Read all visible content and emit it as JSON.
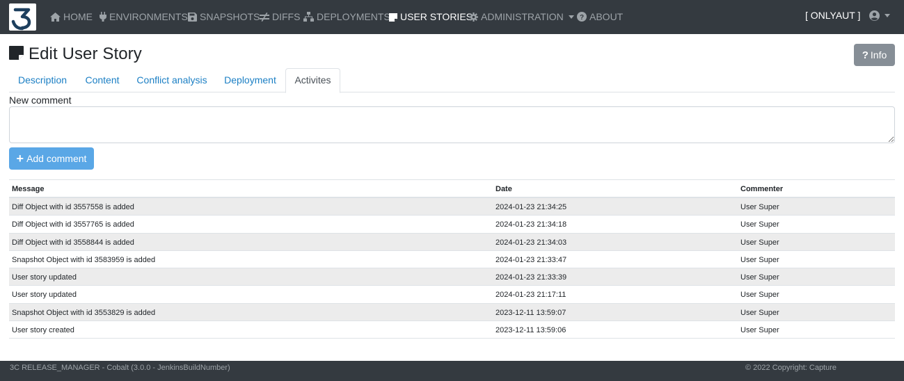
{
  "nav": {
    "items": [
      {
        "label": "HOME",
        "icon": "home-icon"
      },
      {
        "label": "ENVIRONMENTS",
        "icon": "plug-icon"
      },
      {
        "label": "SNAPSHOTS",
        "icon": "floppy-disk-icon"
      },
      {
        "label": "DIFFS",
        "icon": "not-equal-icon"
      },
      {
        "label": "DEPLOYMENTS",
        "icon": "sitemap-icon"
      },
      {
        "label": "USER STORIES",
        "icon": "sticky-note-icon"
      },
      {
        "label": "ADMINISTRATION",
        "icon": "gear-icon"
      },
      {
        "label": "ABOUT",
        "icon": "question-circle-icon"
      }
    ],
    "user": "[ ONLYAUT ]"
  },
  "page": {
    "title": "Edit User Story",
    "info_label": "Info"
  },
  "tabs": [
    "Description",
    "Content",
    "Conflict analysis",
    "Deployment",
    "Activites"
  ],
  "form": {
    "label": "New comment",
    "value": "",
    "add_label": "Add comment"
  },
  "table": {
    "columns": [
      "Message",
      "Date",
      "Commenter"
    ],
    "rows": [
      [
        "Diff Object with id 3557558 is added",
        "2024-01-23 21:34:25",
        "User Super"
      ],
      [
        "Diff Object with id 3557765 is added",
        "2024-01-23 21:34:18",
        "User Super"
      ],
      [
        "Diff Object with id 3558844 is added",
        "2024-01-23 21:34:03",
        "User Super"
      ],
      [
        "Snapshot Object with id 3583959 is added",
        "2024-01-23 21:33:47",
        "User Super"
      ],
      [
        "User story updated",
        "2024-01-23 21:33:39",
        "User Super"
      ],
      [
        "User story updated",
        "2024-01-23 21:17:11",
        "User Super"
      ],
      [
        "Snapshot Object with id 3553829 is added",
        "2023-12-11 13:59:07",
        "User Super"
      ],
      [
        "User story created",
        "2023-12-11 13:59:06",
        "User Super"
      ]
    ]
  },
  "footer": {
    "left": "3C RELEASE_MANAGER - Cobalt (3.0.0 - JenkinsBuildNumber)",
    "right": "© 2022 Copyright: Capture"
  },
  "colors": {
    "navbar": "#343a40",
    "link": "#1b7fc4",
    "primary_button": "#5aa7e6",
    "info_button": "#868e96",
    "stripe": "#ececec"
  }
}
